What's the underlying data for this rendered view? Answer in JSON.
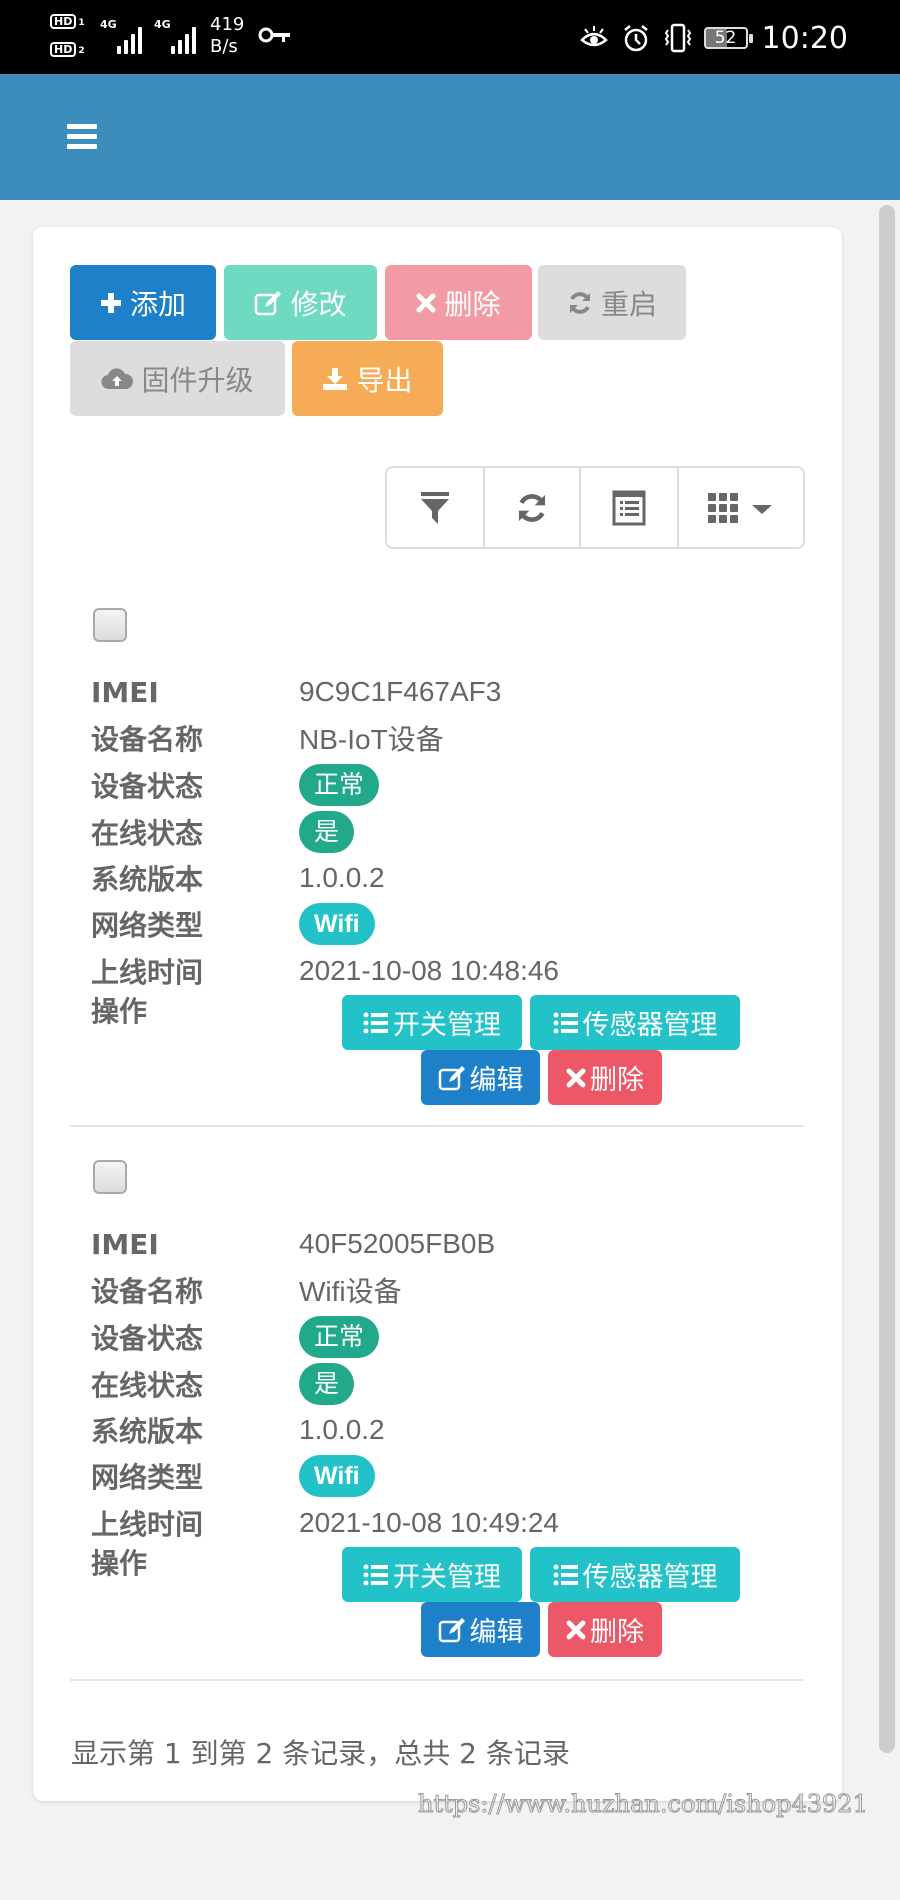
{
  "status_bar": {
    "sim1_label": "HD",
    "sim1_num": "1",
    "sim2_label": "HD",
    "sim2_num": "2",
    "network1": "4G",
    "network2": "4G",
    "speed_value": "419",
    "speed_unit": "B/s",
    "battery": "52",
    "time": "10:20",
    "icons": [
      "vpn-key-icon",
      "eye-comfort-icon",
      "alarm-icon",
      "vibrate-icon",
      "battery-icon"
    ]
  },
  "navbar": {
    "menu_icon": "hamburger-icon"
  },
  "actions": {
    "add": "添加",
    "edit": "修改",
    "delete": "删除",
    "restart": "重启",
    "firmware": "固件升级",
    "export": "导出"
  },
  "toolbar": {
    "filter_icon": "filter-icon",
    "refresh_icon": "refresh-icon",
    "toggle_view_icon": "list-view-icon",
    "columns_icon": "columns-grid-icon"
  },
  "labels": {
    "imei": "IMEI",
    "name": "设备名称",
    "device_status": "设备状态",
    "online_status": "在线状态",
    "version": "系统版本",
    "network_type": "网络类型",
    "online_time": "上线时间",
    "operations": "操作"
  },
  "row_actions": {
    "switch_mgmt": "开关管理",
    "sensor_mgmt": "传感器管理",
    "edit": "编辑",
    "delete": "删除"
  },
  "records": [
    {
      "imei": "9C9C1F467AF3",
      "name": "NB-IoT设备",
      "device_status": "正常",
      "online_status": "是",
      "version": "1.0.0.2",
      "network_type": "Wifi",
      "online_time": "2021-10-08 10:48:46"
    },
    {
      "imei": "40F52005FB0B",
      "name": "Wifi设备",
      "device_status": "正常",
      "online_status": "是",
      "version": "1.0.0.2",
      "network_type": "Wifi",
      "online_time": "2021-10-08 10:49:24"
    }
  ],
  "pagination": {
    "summary": "显示第 1 到第 2 条记录，总共 2 条记录"
  },
  "watermark": "https://www.huzhan.com/ishop43921",
  "colors": {
    "navbar": "#3c8dbc",
    "primary": "#1e80c8",
    "success_badge": "#22a88a",
    "info": "#22c2c8",
    "danger": "#ec5867",
    "warning": "#f6ab57"
  }
}
